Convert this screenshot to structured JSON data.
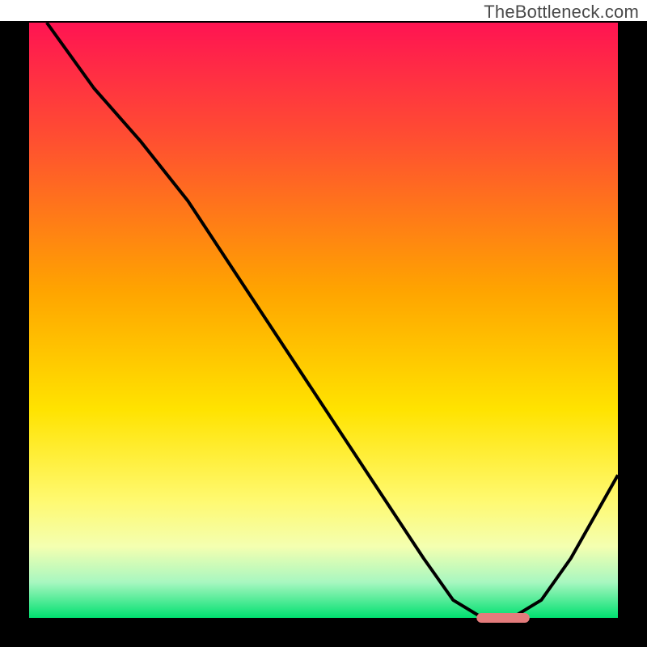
{
  "watermark": "TheBottleneck.com",
  "chart_data": {
    "type": "line",
    "title": "",
    "xlabel": "",
    "ylabel": "",
    "xlim": [
      0,
      100
    ],
    "ylim": [
      0,
      100
    ],
    "grid": false,
    "axes_visible": false,
    "x": [
      3,
      11,
      19,
      27,
      35,
      43,
      51,
      59,
      67,
      72,
      77,
      82,
      87,
      92,
      100
    ],
    "values": [
      100,
      89,
      80,
      70,
      58,
      46,
      34,
      22,
      10,
      3,
      0,
      0,
      3,
      10,
      24
    ],
    "optimum_marker": {
      "x_start": 76,
      "x_end": 85,
      "y": 0
    },
    "background_gradient": {
      "stops": [
        {
          "offset": 0.0,
          "color": "#ff1452"
        },
        {
          "offset": 0.2,
          "color": "#ff5030"
        },
        {
          "offset": 0.45,
          "color": "#ffa400"
        },
        {
          "offset": 0.65,
          "color": "#ffe300"
        },
        {
          "offset": 0.8,
          "color": "#fff96e"
        },
        {
          "offset": 0.88,
          "color": "#f4ffb0"
        },
        {
          "offset": 0.94,
          "color": "#a8f7c0"
        },
        {
          "offset": 1.0,
          "color": "#00e070"
        }
      ]
    },
    "colors": {
      "plot_margin": "#000000",
      "line": "#000000",
      "marker": "#e47c7c"
    }
  }
}
